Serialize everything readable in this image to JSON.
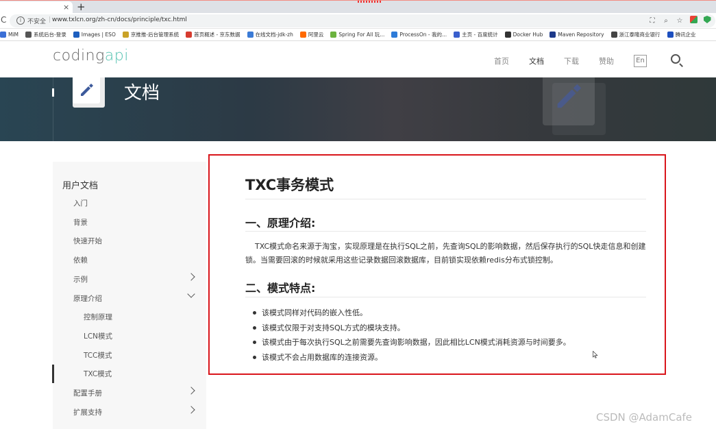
{
  "browser": {
    "tab_close": "×",
    "tab_new": "+",
    "reload": "C",
    "security_label": "不安全",
    "separator": "|",
    "url": "www.txlcn.org/zh-cn/docs/principle/txc.html",
    "bookmarks": [
      {
        "label": "MiM",
        "color": "#3b6fd6"
      },
      {
        "label": "系统后台-登录",
        "color": "#555555"
      },
      {
        "label": "Images | ESO",
        "color": "#1d5fbf"
      },
      {
        "label": "京推推-后台管理系统",
        "color": "#c9a227"
      },
      {
        "label": "首页概述 - 京东数据",
        "color": "#d63b2f"
      },
      {
        "label": "在线文档-jdk-zh",
        "color": "#3b7bd6"
      },
      {
        "label": "阿里云",
        "color": "#ff6a00"
      },
      {
        "label": "Spring For All 玩...",
        "color": "#6cb33f"
      },
      {
        "label": "ProcessOn - 我的...",
        "color": "#2d7bd8"
      },
      {
        "label": "主页 - 百度统计",
        "color": "#3a5fcd"
      },
      {
        "label": "Docker Hub",
        "color": "#333333"
      },
      {
        "label": "Maven Repository",
        "color": "#1e3a8a"
      },
      {
        "label": "浙江泰隆商业银行",
        "color": "#444444"
      },
      {
        "label": "腾讯企业",
        "color": "#1d4fbf"
      }
    ]
  },
  "header": {
    "logo_part1": "coding",
    "logo_part2": "api",
    "nav": [
      {
        "label": "首页",
        "active": false
      },
      {
        "label": "文档",
        "active": true
      },
      {
        "label": "下载",
        "active": false
      },
      {
        "label": "赞助",
        "active": false
      }
    ],
    "lang": "En"
  },
  "banner": {
    "title": "文档"
  },
  "sidebar": {
    "title": "用户文档",
    "items": [
      {
        "label": "入门",
        "level": 1,
        "chevron": ""
      },
      {
        "label": "背景",
        "level": 1,
        "chevron": ""
      },
      {
        "label": "快速开始",
        "level": 1,
        "chevron": ""
      },
      {
        "label": "依赖",
        "level": 1,
        "chevron": ""
      },
      {
        "label": "示例",
        "level": 1,
        "chevron": "right"
      },
      {
        "label": "原理介绍",
        "level": 1,
        "chevron": "down"
      },
      {
        "label": "控制原理",
        "level": 2,
        "chevron": ""
      },
      {
        "label": "LCN模式",
        "level": 2,
        "chevron": ""
      },
      {
        "label": "TCC模式",
        "level": 2,
        "chevron": ""
      },
      {
        "label": "TXC模式",
        "level": 2,
        "chevron": "",
        "active": true
      },
      {
        "label": "配置手册",
        "level": 1,
        "chevron": "right"
      },
      {
        "label": "扩展支持",
        "level": 1,
        "chevron": "right"
      }
    ]
  },
  "content": {
    "title": "TXC事务模式",
    "section1_title": "一、原理介绍:",
    "section1_text": "TXC模式命名来源于淘宝，实现原理是在执行SQL之前，先查询SQL的影响数据，然后保存执行的SQL快走信息和创建锁。当需要回滚的时候就采用这些记录数据回滚数据库，目前锁实现依赖redis分布式锁控制。",
    "section2_title": "二、模式特点:",
    "features": [
      "该模式同样对代码的嵌入性低。",
      "该模式仅限于对支持SQL方式的模块支持。",
      "该模式由于每次执行SQL之前需要先查询影响数据，因此相比LCN模式消耗资源与时间要多。",
      "该模式不会占用数据库的连接资源。"
    ]
  },
  "watermark": "CSDN @AdamCafe"
}
